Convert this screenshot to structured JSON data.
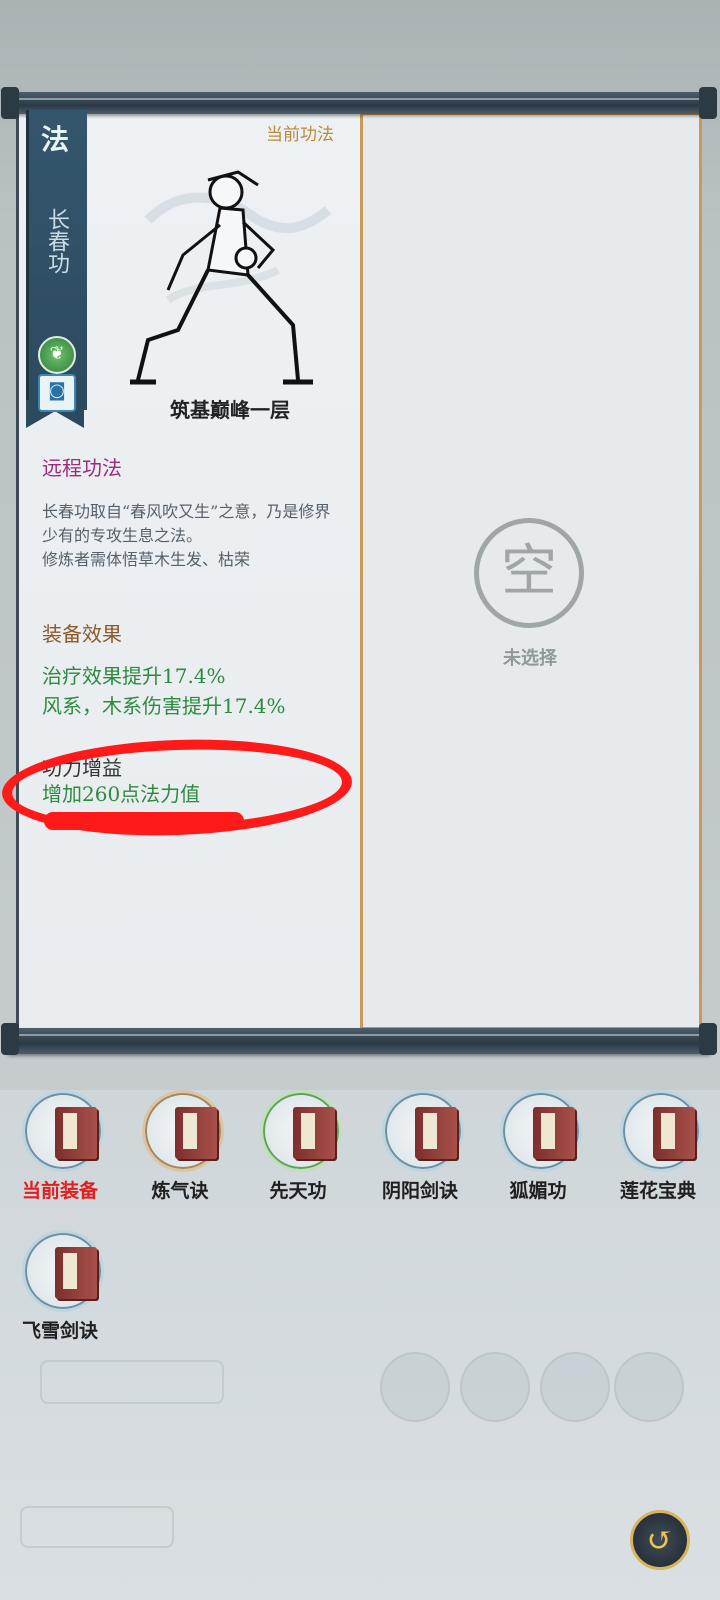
{
  "skill": {
    "type_glyph": "法",
    "name": "长春功",
    "element_icon": "wood-element-icon",
    "seal_icon": "seal-icon",
    "current_label": "当前功法",
    "realm": "筑基巅峰一层",
    "category": "远程功法",
    "description": "长春功取自“春风吹又生”之意，乃是修界少有的专攻生息之法。\n修炼者需体悟草木生发、枯荣",
    "effect_title": "装备效果",
    "effects": [
      "治疗效果提升17.4%",
      "风系，木系伤害提升17.4%"
    ],
    "gain_title": "功力增益",
    "gain": "增加260点法力值"
  },
  "right_panel": {
    "empty_glyph": "空",
    "empty_text": "未选择"
  },
  "books": [
    {
      "label": "当前装备",
      "active": true
    },
    {
      "label": "炼气诀",
      "active": false
    },
    {
      "label": "先天功",
      "active": false
    },
    {
      "label": "阴阳剑诀",
      "active": false
    },
    {
      "label": "狐媚功",
      "active": false
    },
    {
      "label": "莲花宝典",
      "active": false
    },
    {
      "label": "飞雪剑诀",
      "active": false
    }
  ],
  "colors": {
    "highlight_annotation": "#ff1a1a",
    "active_tab": "#e02020",
    "effect_text": "#2e8a3e",
    "category_text": "#9a2d79"
  }
}
